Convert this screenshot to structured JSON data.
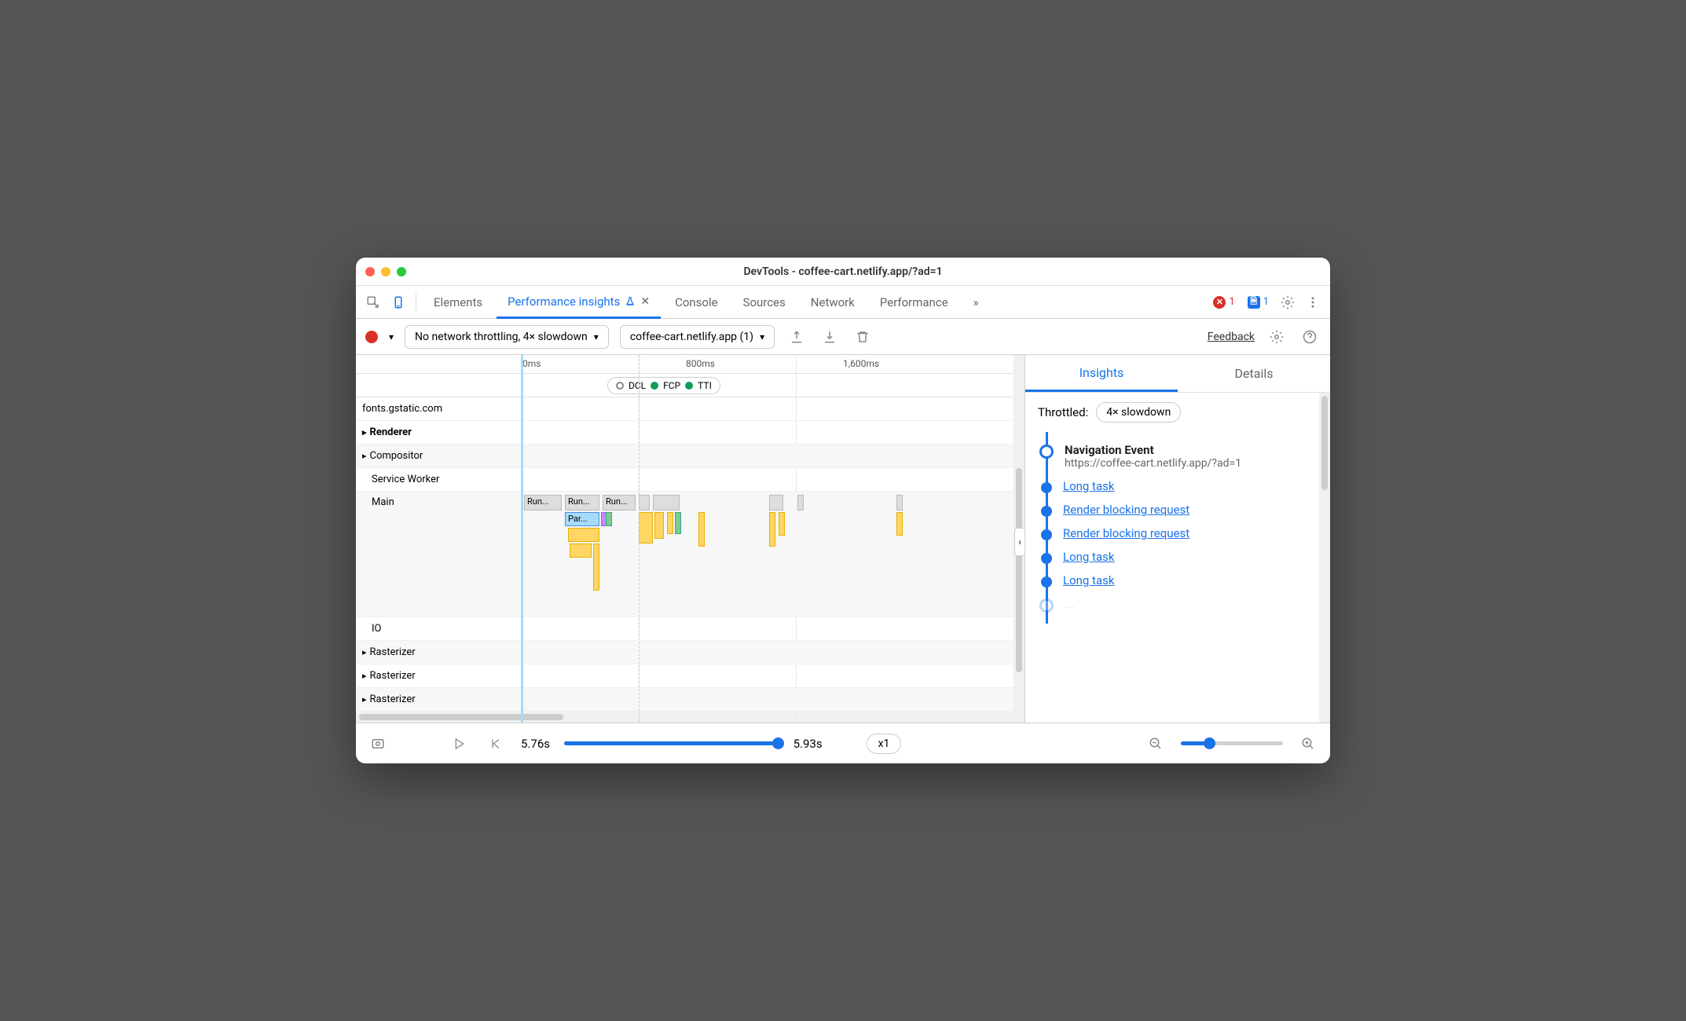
{
  "window": {
    "title": "DevTools - coffee-cart.netlify.app/?ad=1"
  },
  "tabs": {
    "elements": "Elements",
    "perf_insights": "Performance insights",
    "console": "Console",
    "sources": "Sources",
    "network": "Network",
    "performance": "Performance",
    "overflow": "»"
  },
  "badges": {
    "errors": "1",
    "issues": "1"
  },
  "controls": {
    "throttling": "No network throttling, 4× slowdown",
    "url_select": "coffee-cart.netlify.app (1)",
    "feedback": "Feedback"
  },
  "ruler": {
    "t0": "0ms",
    "t1": "800ms",
    "t2": "1,600ms"
  },
  "markers": {
    "dcl": "DCL",
    "fcp": "FCP",
    "tti": "TTI"
  },
  "tracks": {
    "fonts": "fonts.gstatic.com",
    "renderer": "Renderer",
    "compositor": "Compositor",
    "service_worker": "Service Worker",
    "main": "Main",
    "io": "IO",
    "rasterizer1": "Rasterizer",
    "rasterizer2": "Rasterizer",
    "rasterizer3": "Rasterizer"
  },
  "flame": {
    "run": "Run...",
    "parse": "Par..."
  },
  "insights": {
    "tab_insights": "Insights",
    "tab_details": "Details",
    "throttled_label": "Throttled:",
    "throttled_value": "4× slowdown",
    "nav_title": "Navigation Event",
    "nav_url": "https://coffee-cart.netlify.app/?ad=1",
    "long_task": "Long task",
    "render_blocking": "Render blocking request"
  },
  "footer": {
    "current": "5.76s",
    "end": "5.93s",
    "zoom": "x1"
  }
}
